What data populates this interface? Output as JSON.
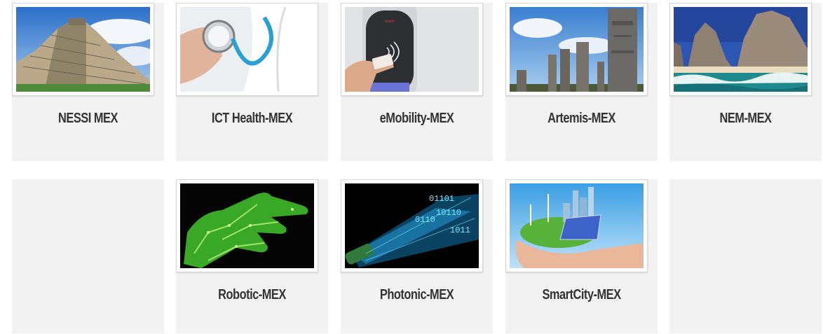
{
  "cards": [
    {
      "label": "NESSI MEX",
      "image": "pyramid-image"
    },
    {
      "label": "ICT Health-MEX",
      "image": "stethoscope-image"
    },
    {
      "label": "eMobility-MEX",
      "image": "nfc-payment-image"
    },
    {
      "label": "Artemis-MEX",
      "image": "stone-statues-image"
    },
    {
      "label": "NEM-MEX",
      "image": "sea-rocks-image"
    },
    {
      "label": "Robotic-MEX",
      "image": "circuit-hand-image"
    },
    {
      "label": "Photonic-MEX",
      "image": "binary-fiber-image"
    },
    {
      "label": "SmartCity-MEX",
      "image": "smart-city-hands-image"
    }
  ],
  "colors": {
    "card_bg": "#f2f2f2",
    "title": "#333333"
  }
}
